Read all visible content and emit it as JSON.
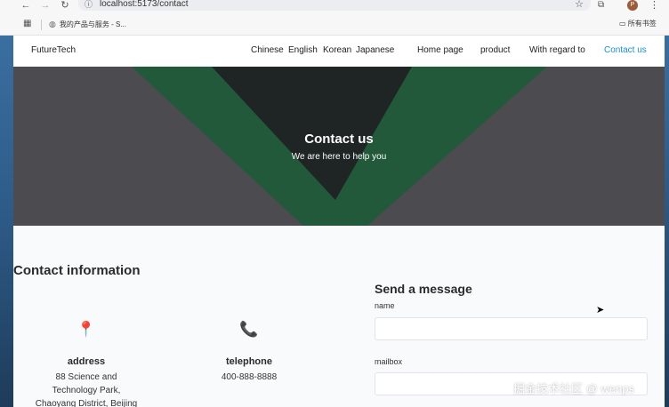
{
  "browser": {
    "url": "localhost:5173/contact",
    "bookmark_label": "我的产品与服务 - S...",
    "bookmarks_folder": "所有书签",
    "avatar_letter": "P"
  },
  "site": {
    "brand": "FutureTech",
    "languages": [
      "Chinese",
      "English",
      "Korean",
      "Japanese"
    ],
    "nav": [
      "Home page",
      "product",
      "With regard to",
      "Contact us"
    ],
    "active_color": "#1a8fd8"
  },
  "hero": {
    "title": "Contact us",
    "subtitle": "We are here to help you"
  },
  "contact_info": {
    "title": "Contact information",
    "address": {
      "label": "address",
      "lines": [
        "88 Science and",
        "Technology Park,",
        "Chaoyang District, Beijing"
      ]
    },
    "telephone": {
      "label": "telephone",
      "value": "400-888-8888"
    }
  },
  "form": {
    "title": "Send a message",
    "name_label": "name",
    "mailbox_label": "mailbox"
  },
  "watermark": "掘金技术社区 @ wenps"
}
